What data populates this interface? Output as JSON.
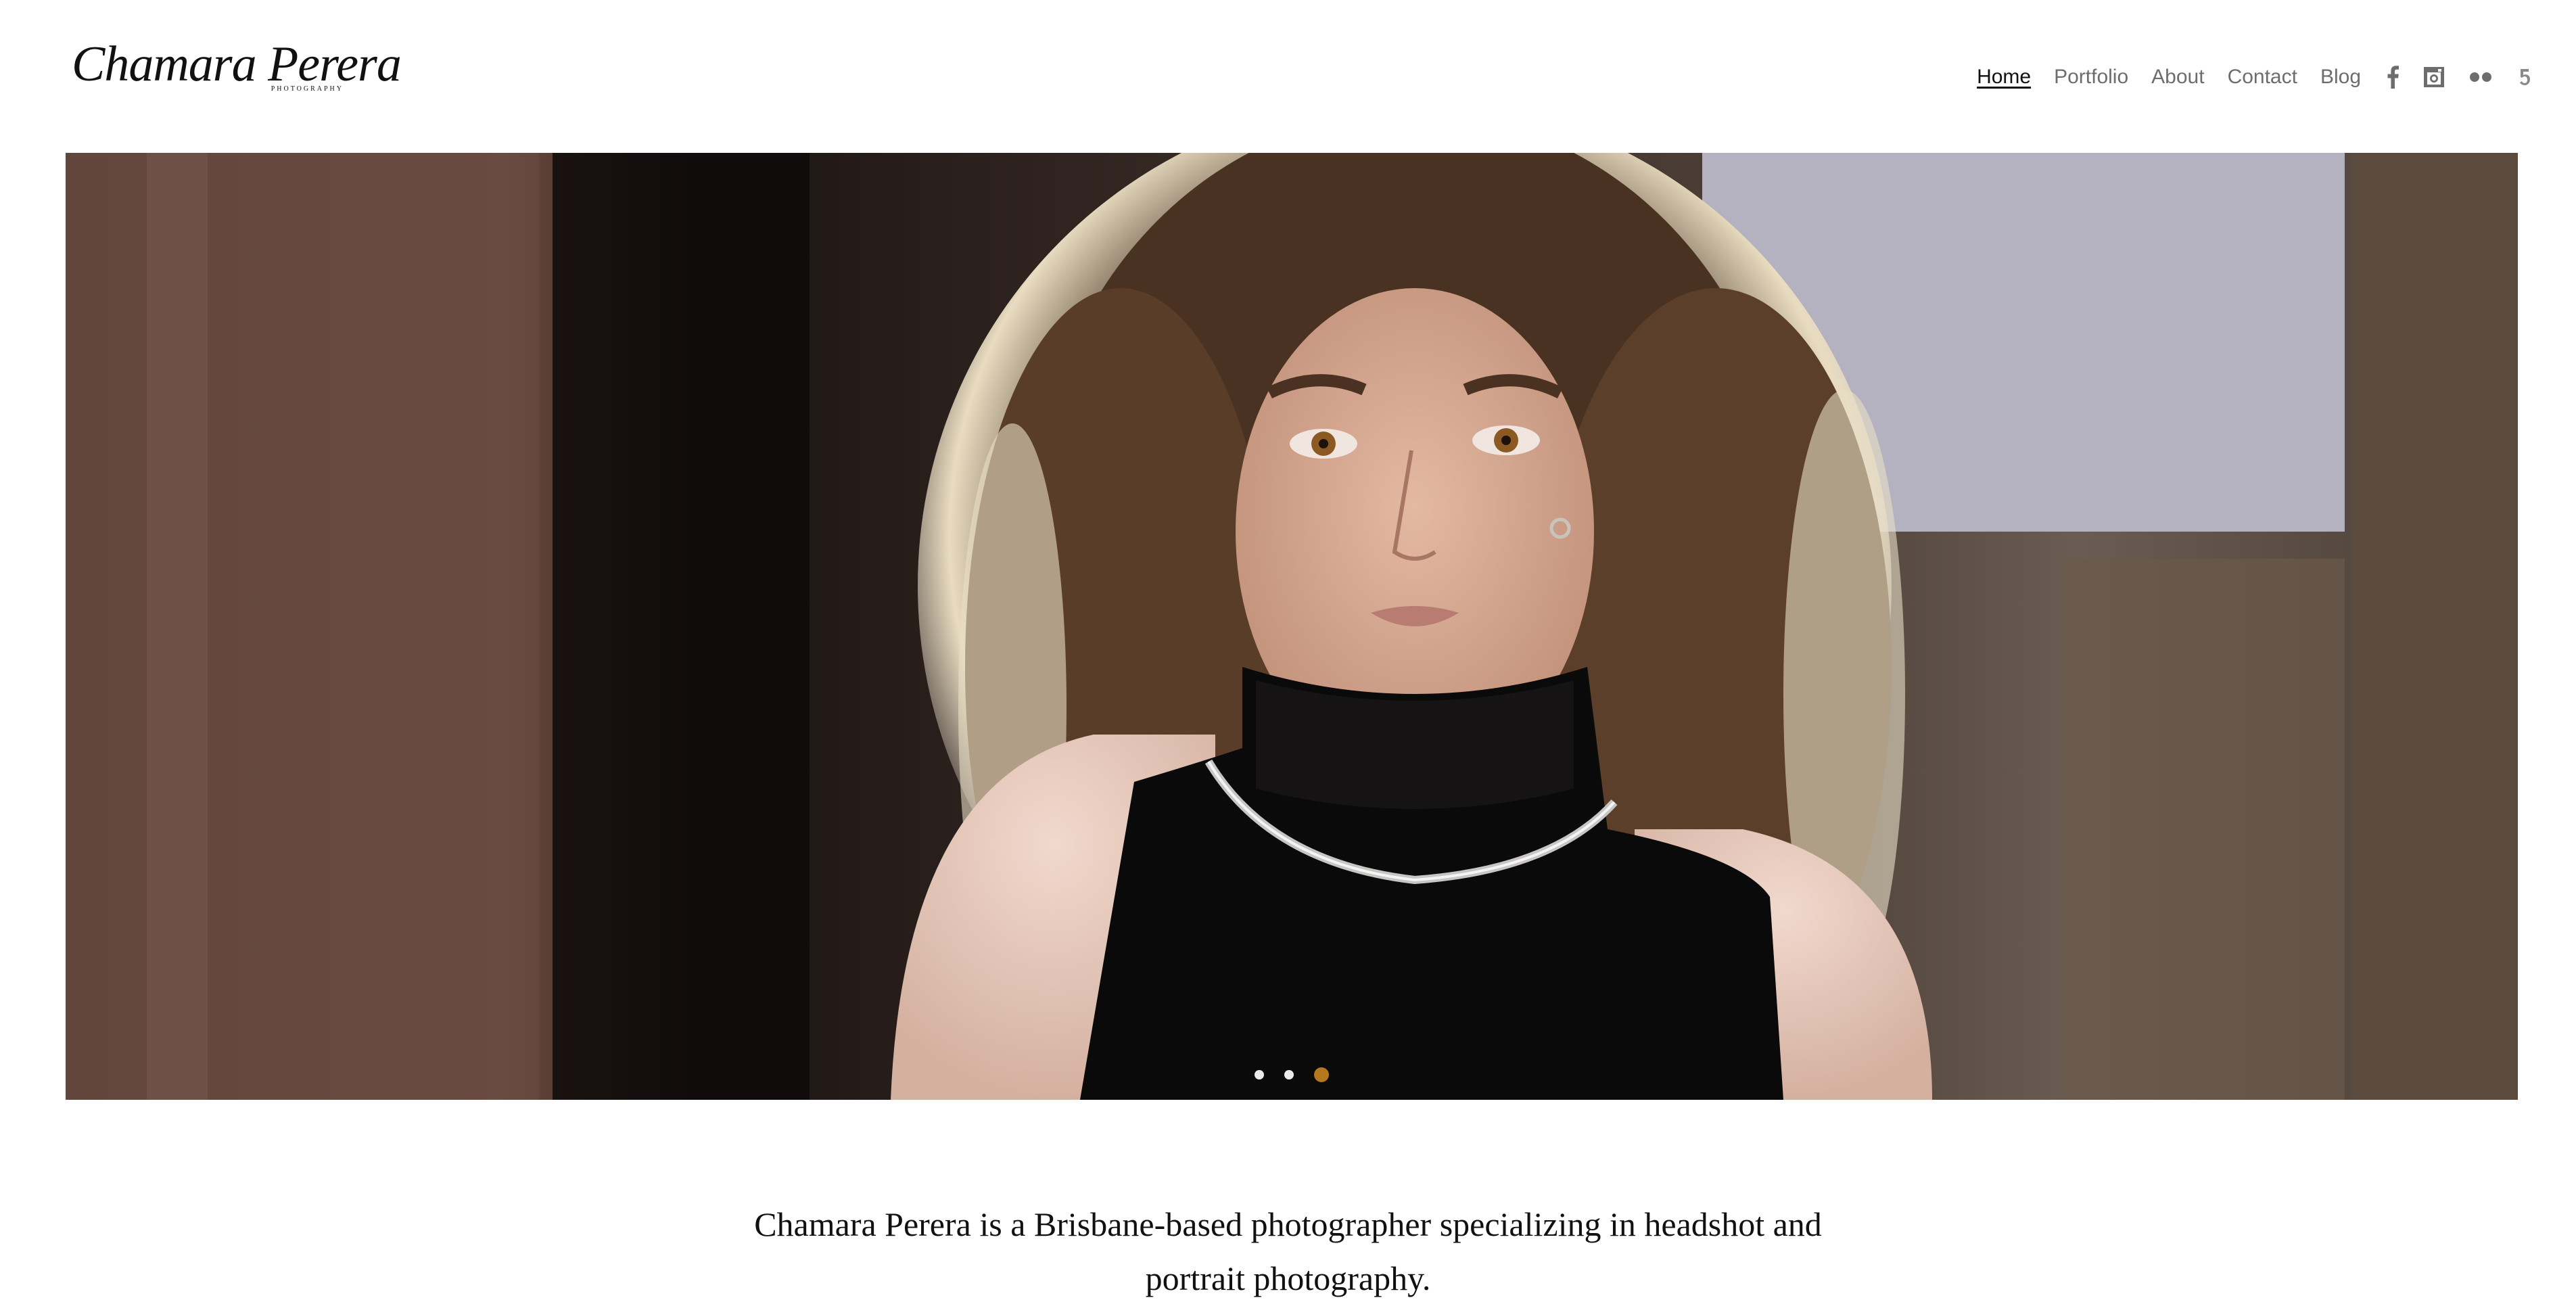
{
  "brand": {
    "logo_script": "Chamara Perera",
    "logo_subtitle": "PHOTOGRAPHY"
  },
  "nav": {
    "items": [
      {
        "label": "Home",
        "active": true
      },
      {
        "label": "Portfolio",
        "active": false
      },
      {
        "label": "About",
        "active": false
      },
      {
        "label": "Contact",
        "active": false
      },
      {
        "label": "Blog",
        "active": false
      }
    ],
    "social": [
      "facebook-icon",
      "instagram-icon",
      "flickr-icon",
      "500px-icon"
    ]
  },
  "slider": {
    "total_slides": 3,
    "active_slide": 3,
    "dot_color": "#ececec",
    "active_dot_color": "#b5781f"
  },
  "intro": {
    "text": "Chamara Perera is a Brisbane-based photographer specializing in headshot and portrait photography."
  }
}
